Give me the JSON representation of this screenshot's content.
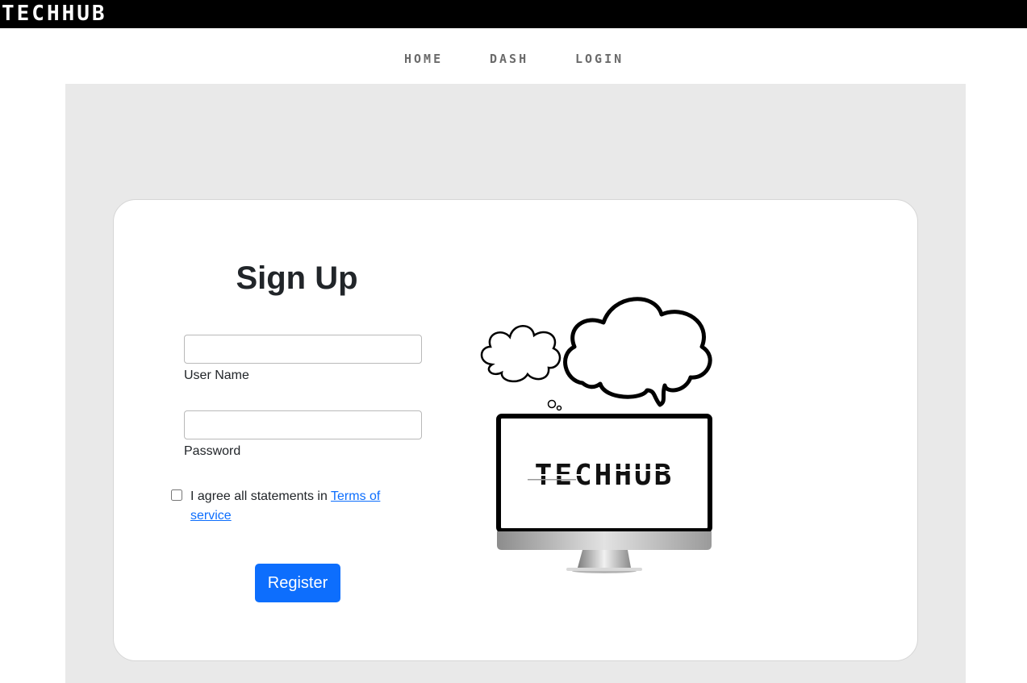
{
  "brand": "TECHHUB",
  "nav": {
    "home": "HOME",
    "dash": "DASH",
    "login": "LOGIN"
  },
  "form": {
    "title": "Sign Up",
    "username": {
      "label": "User Name",
      "value": "",
      "placeholder": ""
    },
    "password": {
      "label": "Password",
      "value": "",
      "placeholder": ""
    },
    "agree_prefix": "I agree all statements in ",
    "terms_link": "Terms of service",
    "register": "Register"
  },
  "illustration": {
    "screen_text": "TECHHUB",
    "icons": [
      "cloud-thought-bubble-small",
      "cloud-speech-bubble-large",
      "computer-monitor"
    ]
  },
  "colors": {
    "topbar": "#000000",
    "accent": "#0d6efd",
    "panel": "#e9e9e9",
    "nav_text": "#6b6b6b"
  }
}
